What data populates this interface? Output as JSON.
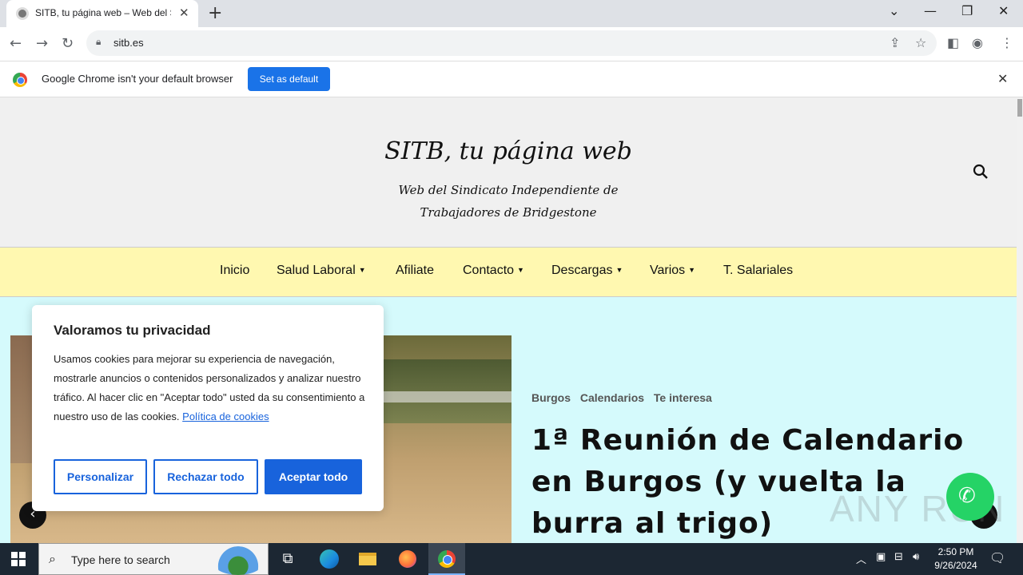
{
  "browser": {
    "tab_title": "SITB, tu página web – Web del Si",
    "url": "sitb.es",
    "new_tab_symbol": "+",
    "window_controls": [
      "⌄",
      "—",
      "❐",
      "✕"
    ]
  },
  "infobar": {
    "message": "Google Chrome isn't your default browser",
    "button": "Set as default"
  },
  "site": {
    "title": "SITB, tu página web",
    "tagline": "Web del Sindicato Independiente de Trabajadores de Bridgestone",
    "nav": [
      {
        "label": "Inicio",
        "has_dropdown": false
      },
      {
        "label": "Salud Laboral",
        "has_dropdown": true
      },
      {
        "label": "Afiliate",
        "has_dropdown": false
      },
      {
        "label": "Contacto",
        "has_dropdown": true
      },
      {
        "label": "Descargas",
        "has_dropdown": true
      },
      {
        "label": "Varios",
        "has_dropdown": true
      },
      {
        "label": "T. Salariales",
        "has_dropdown": false
      }
    ]
  },
  "post": {
    "categories": [
      "Burgos",
      "Calendarios",
      "Te interesa"
    ],
    "title": "1ª Reunión de Calendario en Burgos (y vuelta la burra al trigo)"
  },
  "cookie": {
    "title": "Valoramos tu privacidad",
    "body": "Usamos cookies para mejorar su experiencia de navegación, mostrarle anuncios o contenidos personalizados y analizar nuestro tráfico. Al hacer clic en \"Aceptar todo\" usted da su consentimiento a nuestro uso de las cookies.",
    "link": "Política de cookies",
    "buttons": {
      "customize": "Personalizar",
      "reject": "Rechazar todo",
      "accept": "Aceptar todo"
    }
  },
  "overlay": {
    "watermark": "ANY RUN"
  },
  "taskbar": {
    "search_placeholder": "Type here to search",
    "time": "2:50 PM",
    "date": "9/26/2024"
  },
  "colors": {
    "accent_blue": "#1863dc",
    "nav_bg": "#fff8b0",
    "page_bg": "#d5fafc",
    "whatsapp": "#25d366"
  }
}
